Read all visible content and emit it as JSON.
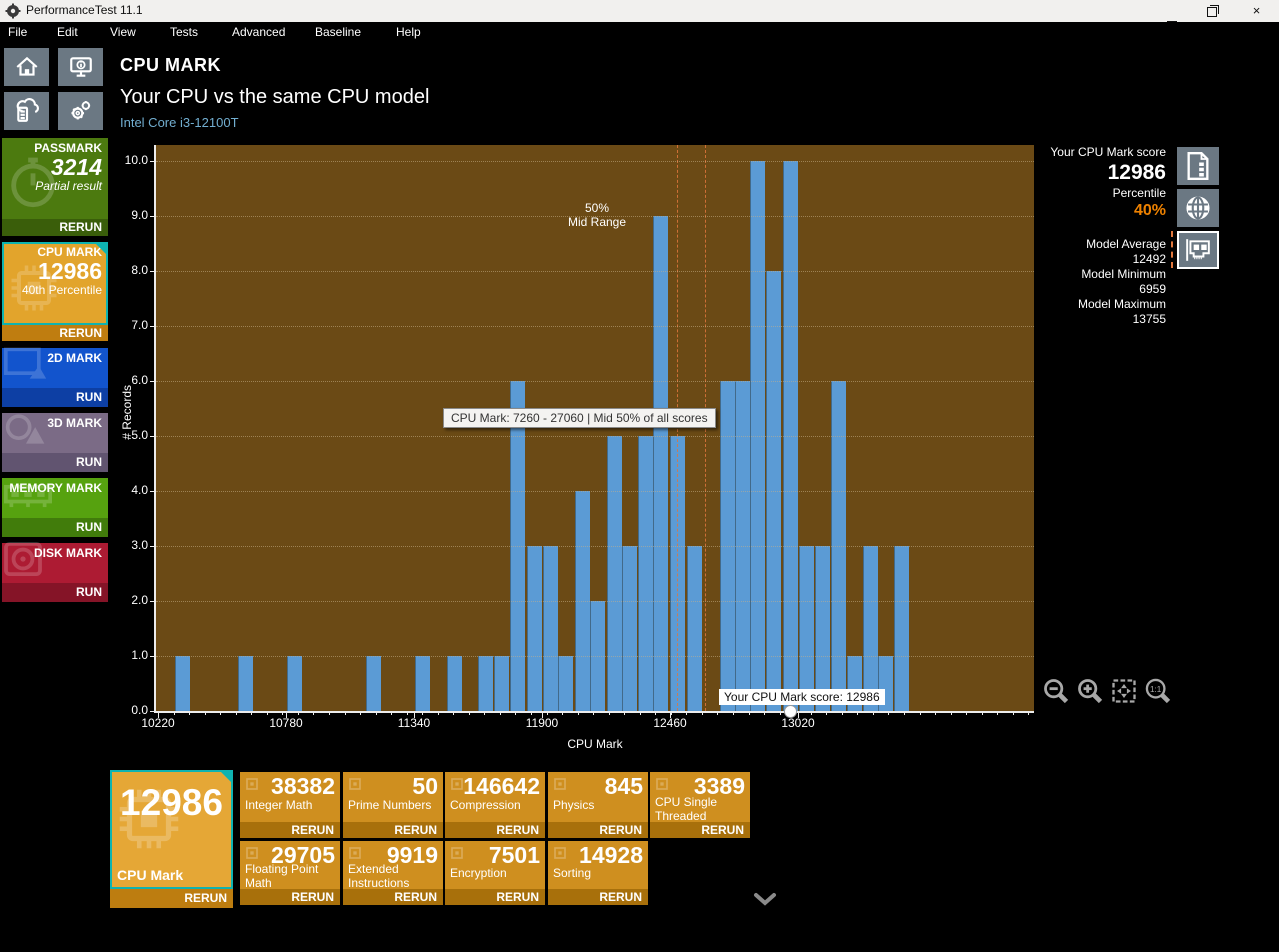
{
  "window": {
    "title": "PerformanceTest 11.1"
  },
  "menu": {
    "items": [
      "File",
      "Edit",
      "View",
      "Tests",
      "Advanced",
      "Baseline",
      "Help"
    ]
  },
  "sidebar": {
    "tiles": [
      {
        "name": "PASSMARK",
        "score": "3214",
        "subtitle": "Partial result",
        "action": "RERUN",
        "color": "#4c7a0f",
        "footer_color": "#3a5e0a",
        "icon": "stopwatch"
      },
      {
        "name": "CPU MARK",
        "score": "12986",
        "subtitle": "40th Percentile",
        "action": "RERUN",
        "color": "#e2a42c",
        "footer_color": "#bf7d10",
        "icon": "cpu-chip",
        "selected": true
      },
      {
        "name": "2D MARK",
        "action": "RUN",
        "color": "#1254cd",
        "footer_color": "#0d3fa4",
        "icon": "picture"
      },
      {
        "name": "3D MARK",
        "action": "RUN",
        "color": "#7b6b86",
        "footer_color": "#615470",
        "icon": "shapes"
      },
      {
        "name": "MEMORY MARK",
        "action": "RUN",
        "color": "#56a20f",
        "footer_color": "#417c0b",
        "icon": "ram"
      },
      {
        "name": "DISK MARK",
        "action": "RUN",
        "color": "#ad1b33",
        "footer_color": "#851427",
        "icon": "disk"
      }
    ]
  },
  "header": {
    "title": "CPU MARK",
    "subtitle": "Your CPU vs the same CPU model",
    "cpu_model": "Intel Core i3-12100T"
  },
  "chart_data": {
    "type": "bar",
    "subtype": "histogram",
    "xlabel": "CPU Mark",
    "ylabel": "# Records",
    "xlim": [
      10211,
      14052
    ],
    "ylim": [
      0,
      10.3
    ],
    "x_ticks": [
      10220,
      10780,
      11340,
      11900,
      12460,
      13020
    ],
    "y_ticks": [
      "0.0",
      "1.0",
      "2.0",
      "3.0",
      "4.0",
      "5.0",
      "6.0",
      "7.0",
      "8.0",
      "9.0",
      "10.0"
    ],
    "grid": "horizontal-dotted",
    "bin_width": 68,
    "bar_color": "#5b9bd5",
    "plot_bg": "#6b4a15",
    "bars": [
      {
        "x": 10328,
        "h": 1
      },
      {
        "x": 10604,
        "h": 1
      },
      {
        "x": 10819,
        "h": 1
      },
      {
        "x": 11164,
        "h": 1
      },
      {
        "x": 11378,
        "h": 1
      },
      {
        "x": 11518,
        "h": 1
      },
      {
        "x": 11654,
        "h": 1
      },
      {
        "x": 11724,
        "h": 1
      },
      {
        "x": 11794,
        "h": 6
      },
      {
        "x": 11868,
        "h": 3
      },
      {
        "x": 11938,
        "h": 3
      },
      {
        "x": 12004,
        "h": 1
      },
      {
        "x": 12078,
        "h": 4
      },
      {
        "x": 12144,
        "h": 2
      },
      {
        "x": 12218,
        "h": 5
      },
      {
        "x": 12284,
        "h": 3
      },
      {
        "x": 12354,
        "h": 5
      },
      {
        "x": 12420,
        "h": 9
      },
      {
        "x": 12494,
        "h": 5
      },
      {
        "x": 12568,
        "h": 3
      },
      {
        "x": 12713,
        "h": 6
      },
      {
        "x": 12778,
        "h": 6
      },
      {
        "x": 12844,
        "h": 10
      },
      {
        "x": 12914,
        "h": 8
      },
      {
        "x": 12988,
        "h": 10
      },
      {
        "x": 13058,
        "h": 3
      },
      {
        "x": 13128,
        "h": 3
      },
      {
        "x": 13198,
        "h": 6
      },
      {
        "x": 13268,
        "h": 1
      },
      {
        "x": 13338,
        "h": 3
      },
      {
        "x": 13404,
        "h": 1
      },
      {
        "x": 13474,
        "h": 3
      }
    ],
    "dashed_lines": [
      12491,
      12613
    ],
    "dashed_line_color": "#e0763c",
    "mid_range_line1": "50%",
    "mid_range_line2": "Mid Range",
    "tooltip": "CPU Mark: 7260 - 27060 | Mid 50% of all scores",
    "score_tooltip": "Your CPU Mark score: 12986",
    "score_value": 12986
  },
  "right_panel": {
    "score_label": "Your CPU Mark score",
    "score": "12986",
    "percentile_label": "Percentile",
    "percentile": "40%",
    "percentile_color": "#ef8200",
    "stats": [
      {
        "label": "Model Average",
        "value": "12492"
      },
      {
        "label": "Model Minimum",
        "value": "6959"
      },
      {
        "label": "Model Maximum",
        "value": "13755"
      }
    ],
    "icons": [
      "report-icon",
      "globe-icon",
      "pci-card-icon"
    ]
  },
  "zoom_controls": [
    "zoom-out",
    "zoom-in",
    "zoom-fit",
    "zoom-one-to-one"
  ],
  "results": {
    "main": {
      "score": "12986",
      "label": "CPU Mark",
      "action": "RERUN"
    },
    "tiles": [
      {
        "score": "38382",
        "label": "Integer Math",
        "action": "RERUN"
      },
      {
        "score": "50",
        "label": "Prime Numbers",
        "action": "RERUN"
      },
      {
        "score": "146642",
        "label": "Compression",
        "action": "RERUN"
      },
      {
        "score": "845",
        "label": "Physics",
        "action": "RERUN"
      },
      {
        "score": "3389",
        "label": "CPU Single Threaded",
        "action": "RERUN"
      },
      {
        "score": "29705",
        "label": "Floating Point Math",
        "action": "RERUN"
      },
      {
        "score": "9919",
        "label": "Extended Instructions (SSE)",
        "action": "RERUN"
      },
      {
        "score": "7501",
        "label": "Encryption",
        "action": "RERUN"
      },
      {
        "score": "14928",
        "label": "Sorting",
        "action": "RERUN"
      }
    ]
  }
}
